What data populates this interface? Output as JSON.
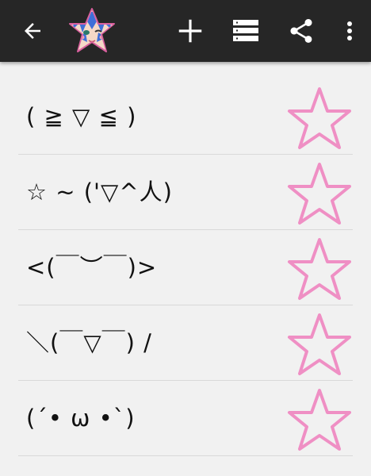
{
  "toolbar": {
    "back_icon": "arrow-back-icon",
    "logo_icon": "star-avatar-logo",
    "add_icon": "plus-icon",
    "list_icon": "list-icon",
    "share_icon": "share-icon",
    "more_icon": "more-vert-icon",
    "background": "#262626"
  },
  "accent_color": "#ef8fc4",
  "emoticons": [
    {
      "text": "( ≧ ▽ ≦ )",
      "favorite": false,
      "fav_icon": "star-outline-icon"
    },
    {
      "text": "☆ ~ ('▽^人)",
      "favorite": false,
      "fav_icon": "star-outline-icon"
    },
    {
      "text": "<(￣︶￣)>",
      "favorite": false,
      "fav_icon": "star-outline-icon"
    },
    {
      "text": "＼(￣▽￣) /",
      "favorite": false,
      "fav_icon": "star-outline-icon"
    },
    {
      "text": "(´• ω •`)",
      "favorite": false,
      "fav_icon": "star-outline-icon"
    }
  ]
}
